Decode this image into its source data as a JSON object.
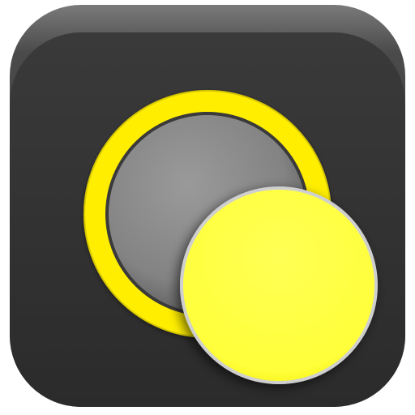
{
  "icon": {
    "name": "toggle-circles-app-icon",
    "colors": {
      "tile_dark": "#2f2f2f",
      "tile_bevel": "#6a6a6a",
      "ring_yellow": "#ffee00",
      "hole_gray": "#8a8a8a",
      "disc_yellow": "#ffff44",
      "disc_rim": "#c8c8c8",
      "background": "#ffffff"
    }
  }
}
